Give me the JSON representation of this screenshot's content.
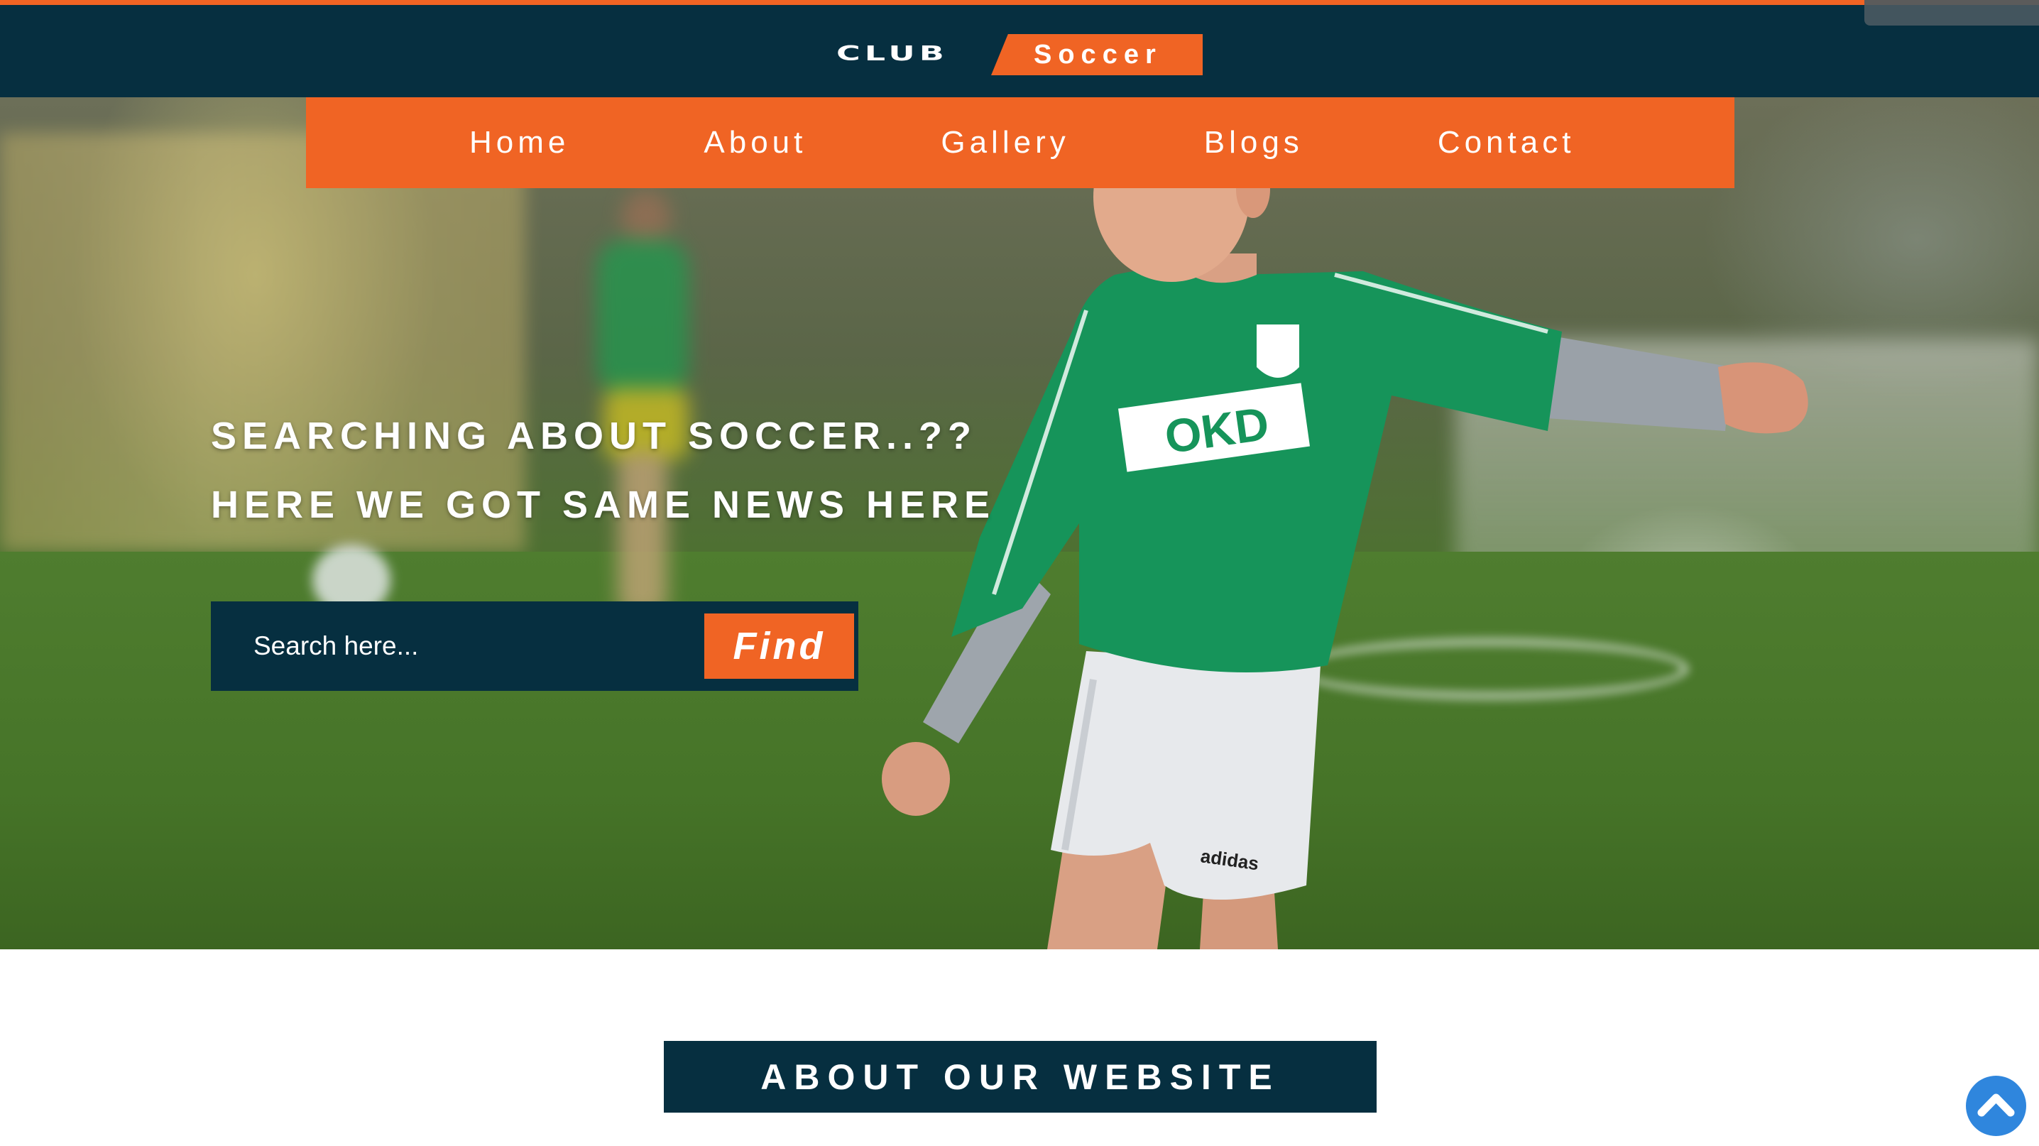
{
  "header": {
    "logo_club": "CLUB",
    "logo_soccer": "Soccer"
  },
  "nav": {
    "items": [
      {
        "label": "Home"
      },
      {
        "label": "About"
      },
      {
        "label": "Gallery"
      },
      {
        "label": "Blogs"
      },
      {
        "label": "Contact"
      }
    ]
  },
  "hero": {
    "title_line1": "SEARCHING ABOUT SOCCER..??",
    "title_line2": "HERE WE GOT SAME NEWS HERE",
    "shirt_sponsor": "OKD",
    "shorts_brand": "adidas",
    "image_subject": "boy-kicking-soccer-ball"
  },
  "search": {
    "placeholder": "Search here...",
    "button_label": "Find"
  },
  "about": {
    "title": "ABOUT OUR WEBSITE"
  },
  "icons": {
    "scroll_top": "chevron-up-icon"
  },
  "colors": {
    "accent": "#f06424",
    "navy": "#062f40",
    "scroll_top": "#2f86dd",
    "shirt_green": "#16945a"
  }
}
